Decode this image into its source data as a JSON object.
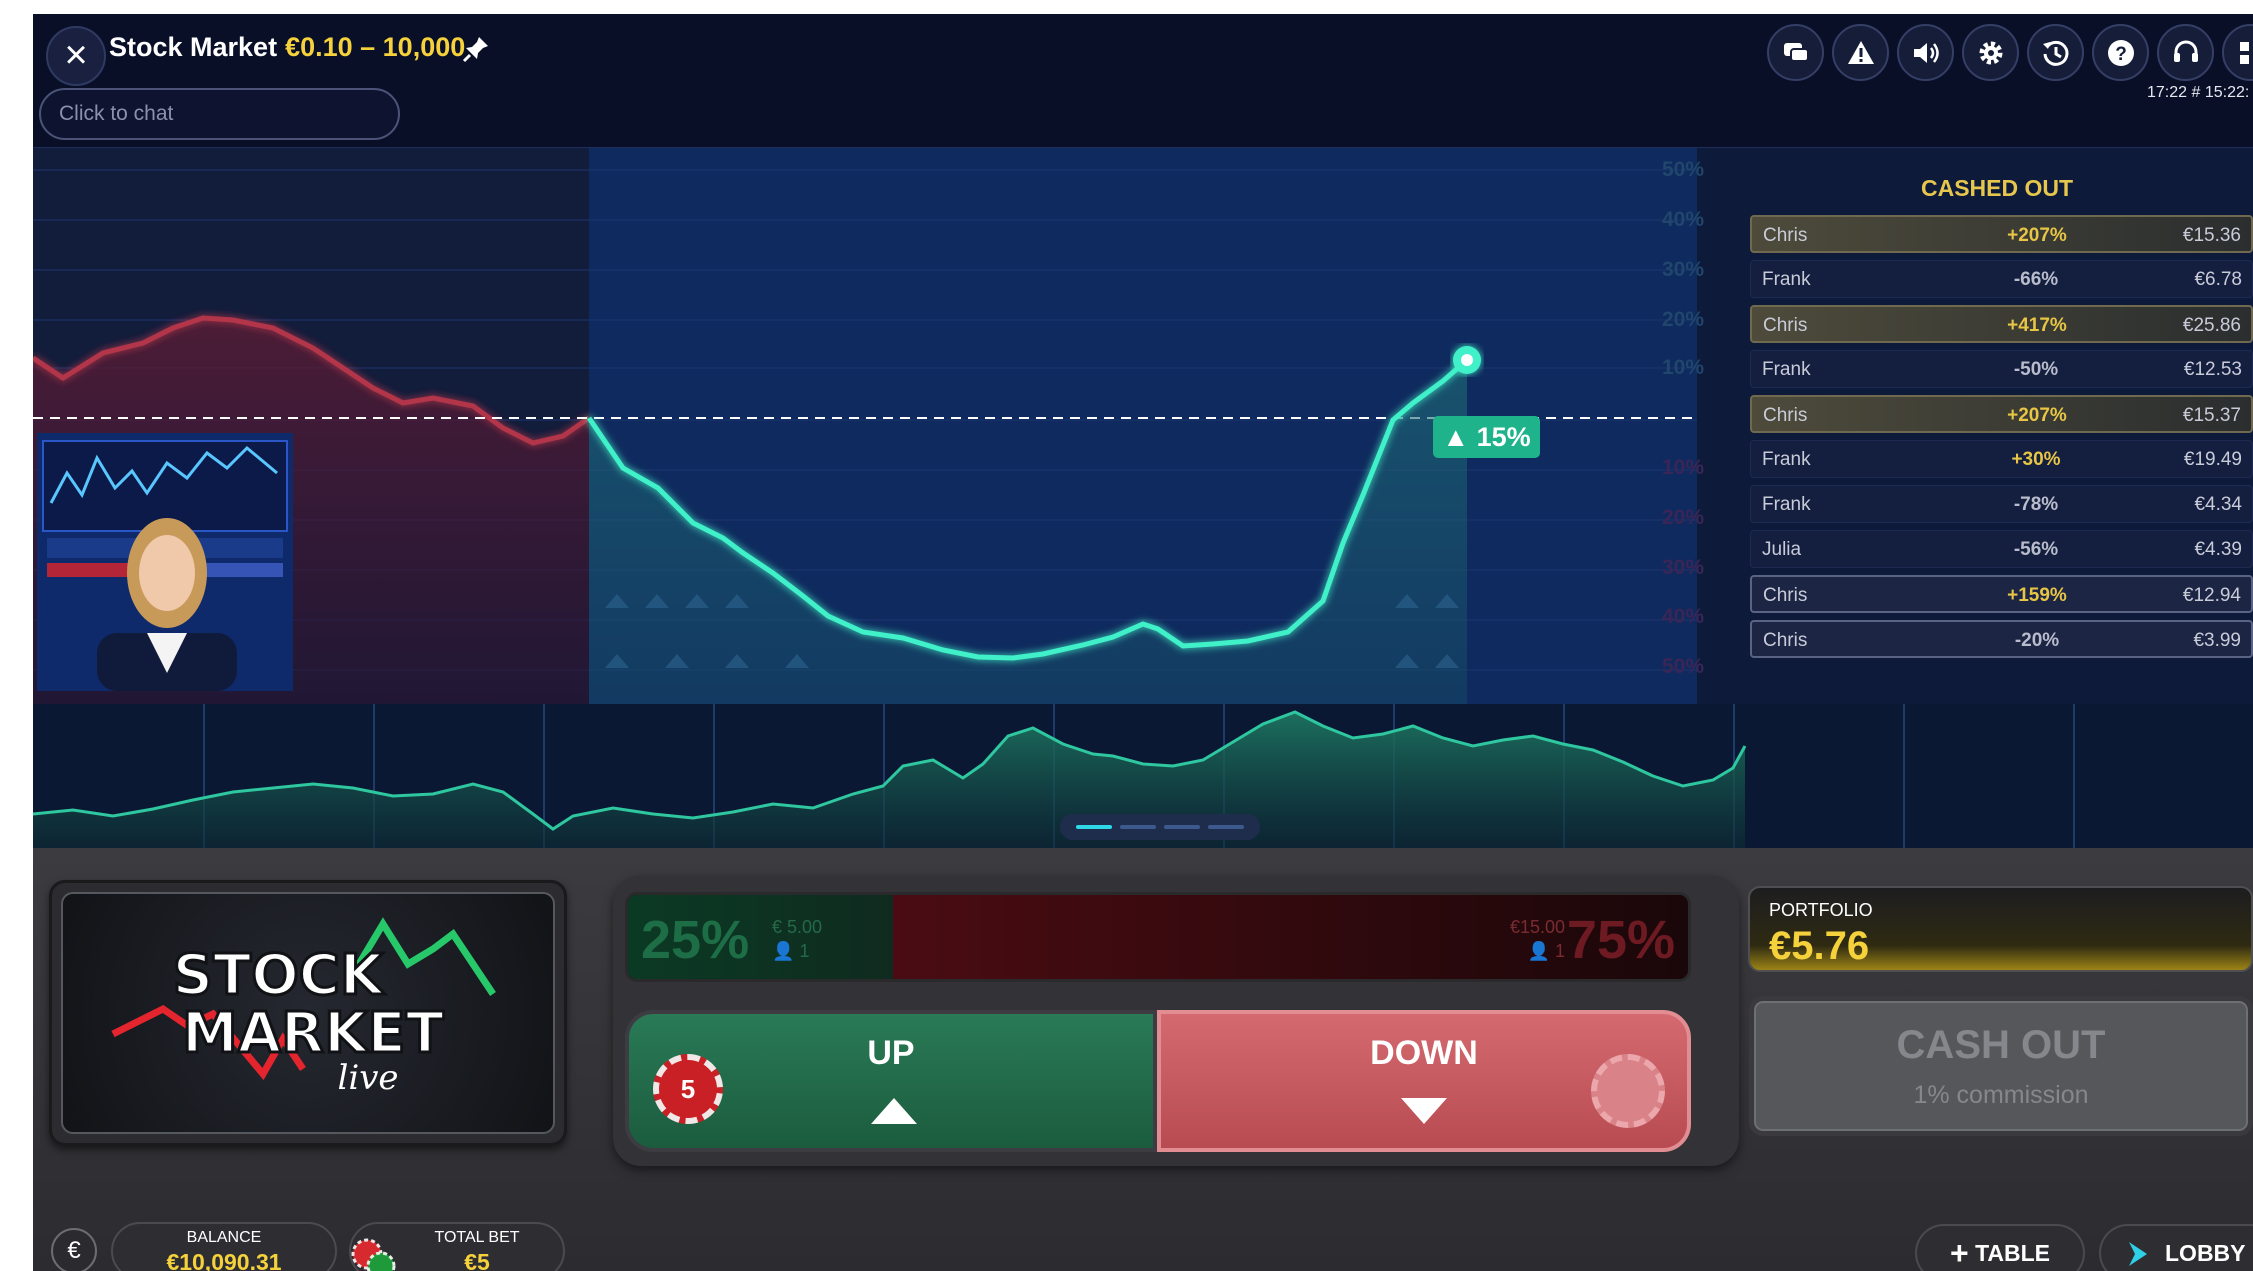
{
  "header": {
    "title": "Stock Market",
    "limits": "€0.10 – 10,000",
    "chat_placeholder": "Click to chat",
    "clock": "17:22 # 15:22:",
    "icons": [
      "chat-icon",
      "warning-icon",
      "sound-icon",
      "settings-icon",
      "history-icon",
      "help-icon",
      "headset-icon",
      "grid-icon"
    ]
  },
  "chart": {
    "y_labels_up": [
      "50%",
      "40%",
      "30%",
      "20%",
      "10%"
    ],
    "y_labels_down": [
      "10%",
      "20%",
      "30%",
      "40%",
      "50%"
    ],
    "current_change": "15%",
    "colors": {
      "up_line": "#36e6c0",
      "down_line": "#c0303e",
      "badge": "#1fb38c",
      "divider": "#35c8ef"
    }
  },
  "cashed_out": {
    "title": "CASHED OUT",
    "rows": [
      {
        "name": "Chris",
        "pct": "+207%",
        "amount": "€15.36",
        "style": "gold"
      },
      {
        "name": "Frank",
        "pct": "-66%",
        "amount": "€6.78",
        "style": "plain"
      },
      {
        "name": "Chris",
        "pct": "+417%",
        "amount": "€25.86",
        "style": "gold"
      },
      {
        "name": "Frank",
        "pct": "-50%",
        "amount": "€12.53",
        "style": "plain"
      },
      {
        "name": "Chris",
        "pct": "+207%",
        "amount": "€15.37",
        "style": "gold"
      },
      {
        "name": "Frank",
        "pct": "+30%",
        "amount": "€19.49",
        "style": "plain"
      },
      {
        "name": "Frank",
        "pct": "-78%",
        "amount": "€4.34",
        "style": "plain"
      },
      {
        "name": "Julia",
        "pct": "-56%",
        "amount": "€4.39",
        "style": "plain"
      },
      {
        "name": "Chris",
        "pct": "+159%",
        "amount": "€12.94",
        "style": "silver"
      },
      {
        "name": "Chris",
        "pct": "-20%",
        "amount": "€3.99",
        "style": "silver"
      }
    ]
  },
  "pager": {
    "pages": 4,
    "active": 1
  },
  "logo": {
    "line1": "STOCK",
    "line2": "MARKET",
    "line3": "live"
  },
  "bets": {
    "up_pct": "25%",
    "up_amount": "€ 5.00",
    "up_players": "1",
    "down_pct": "75%",
    "down_amount": "€15.00",
    "down_players": "1",
    "up_share": 0.25,
    "up_label": "UP",
    "down_label": "DOWN",
    "chip_value": "5"
  },
  "portfolio": {
    "label": "PORTFOLIO",
    "value": "€5.76"
  },
  "cashout": {
    "label": "CASH OUT",
    "commission": "1% commission"
  },
  "footer": {
    "currency": "€",
    "balance_label": "BALANCE",
    "balance_value": "€10,090.31",
    "total_bet_label": "TOTAL BET",
    "total_bet_value": "€5",
    "table_label": "TABLE",
    "lobby_label": "LOBBY"
  }
}
